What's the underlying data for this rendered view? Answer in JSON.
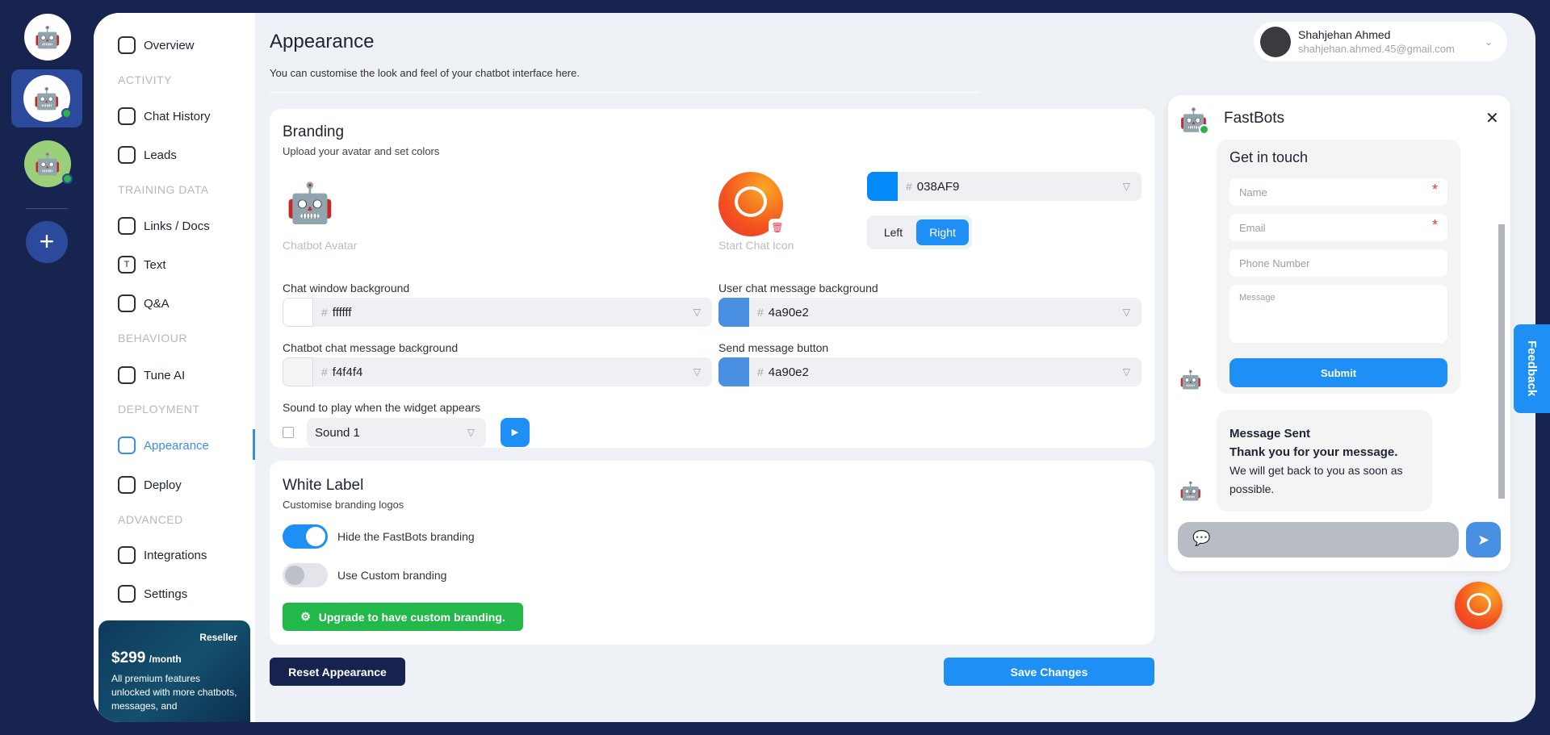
{
  "rail": {
    "add_label": "+"
  },
  "sidebar": {
    "items": [
      {
        "label": "Overview",
        "icon": "grid-icon"
      },
      {
        "label": "Chat History",
        "icon": "chat-history-icon"
      },
      {
        "label": "Leads",
        "icon": "leads-icon"
      },
      {
        "label": "Links / Docs",
        "icon": "link-icon"
      },
      {
        "label": "Text",
        "icon": "text-icon"
      },
      {
        "label": "Q&A",
        "icon": "qa-icon"
      },
      {
        "label": "Tune AI",
        "icon": "sliders-icon"
      },
      {
        "label": "Appearance",
        "icon": "magic-wand-icon"
      },
      {
        "label": "Deploy",
        "icon": "code-icon"
      },
      {
        "label": "Integrations",
        "icon": "integrations-icon"
      },
      {
        "label": "Settings",
        "icon": "settings-icon"
      }
    ],
    "sections": [
      "ACTIVITY",
      "TRAINING DATA",
      "BEHAVIOUR",
      "DEPLOYMENT",
      "ADVANCED"
    ],
    "promo": {
      "badge": "Reseller",
      "price": "$299",
      "period": "/month",
      "text": "All premium features unlocked with more chatbots, messages, and"
    }
  },
  "header": {
    "title": "Appearance",
    "subtitle": "You can customise the look and feel of your chatbot interface here.",
    "user": {
      "name": "Shahjehan Ahmed",
      "email": "shahjehan.ahmed.45@gmail.com"
    }
  },
  "branding": {
    "title": "Branding",
    "subtitle": "Upload your avatar and set colors",
    "avatar_label": "Chatbot Avatar",
    "icon_label": "Start Chat Icon",
    "accent": {
      "hash": "#",
      "value": "038AF9",
      "color": "#038AF9"
    },
    "position": {
      "left": "Left",
      "right": "Right",
      "selected": "Right"
    },
    "fields": [
      {
        "label": "Chat window background",
        "value": "ffffff",
        "color": "#ffffff"
      },
      {
        "label": "User chat message background",
        "value": "4a90e2",
        "color": "#4a90e2"
      },
      {
        "label": "Chatbot chat message background",
        "value": "f4f4f4",
        "color": "#f4f4f4"
      },
      {
        "label": "Send message button",
        "value": "4a90e2",
        "color": "#4a90e2"
      }
    ],
    "sound_label": "Sound to play when the widget appears",
    "sound_value": "Sound 1"
  },
  "white_label": {
    "title": "White Label",
    "subtitle": "Customise branding logos",
    "hide_label": "Hide the FastBots branding",
    "hide_on": true,
    "custom_label": "Use Custom branding",
    "custom_on": false,
    "upgrade_label": "Upgrade to have custom branding."
  },
  "actions": {
    "reset": "Reset Appearance",
    "save": "Save Changes"
  },
  "preview": {
    "title": "FastBots",
    "form_title": "Get in touch",
    "name_ph": "Name",
    "email_ph": "Email",
    "phone_ph": "Phone Number",
    "message_ph": "Message",
    "required": "*",
    "submit": "Submit",
    "sent_title": "Message Sent",
    "sent_thanks": "Thank you for your message.",
    "sent_body": "We will get back to you as soon as possible."
  },
  "feedback": "Feedback"
}
